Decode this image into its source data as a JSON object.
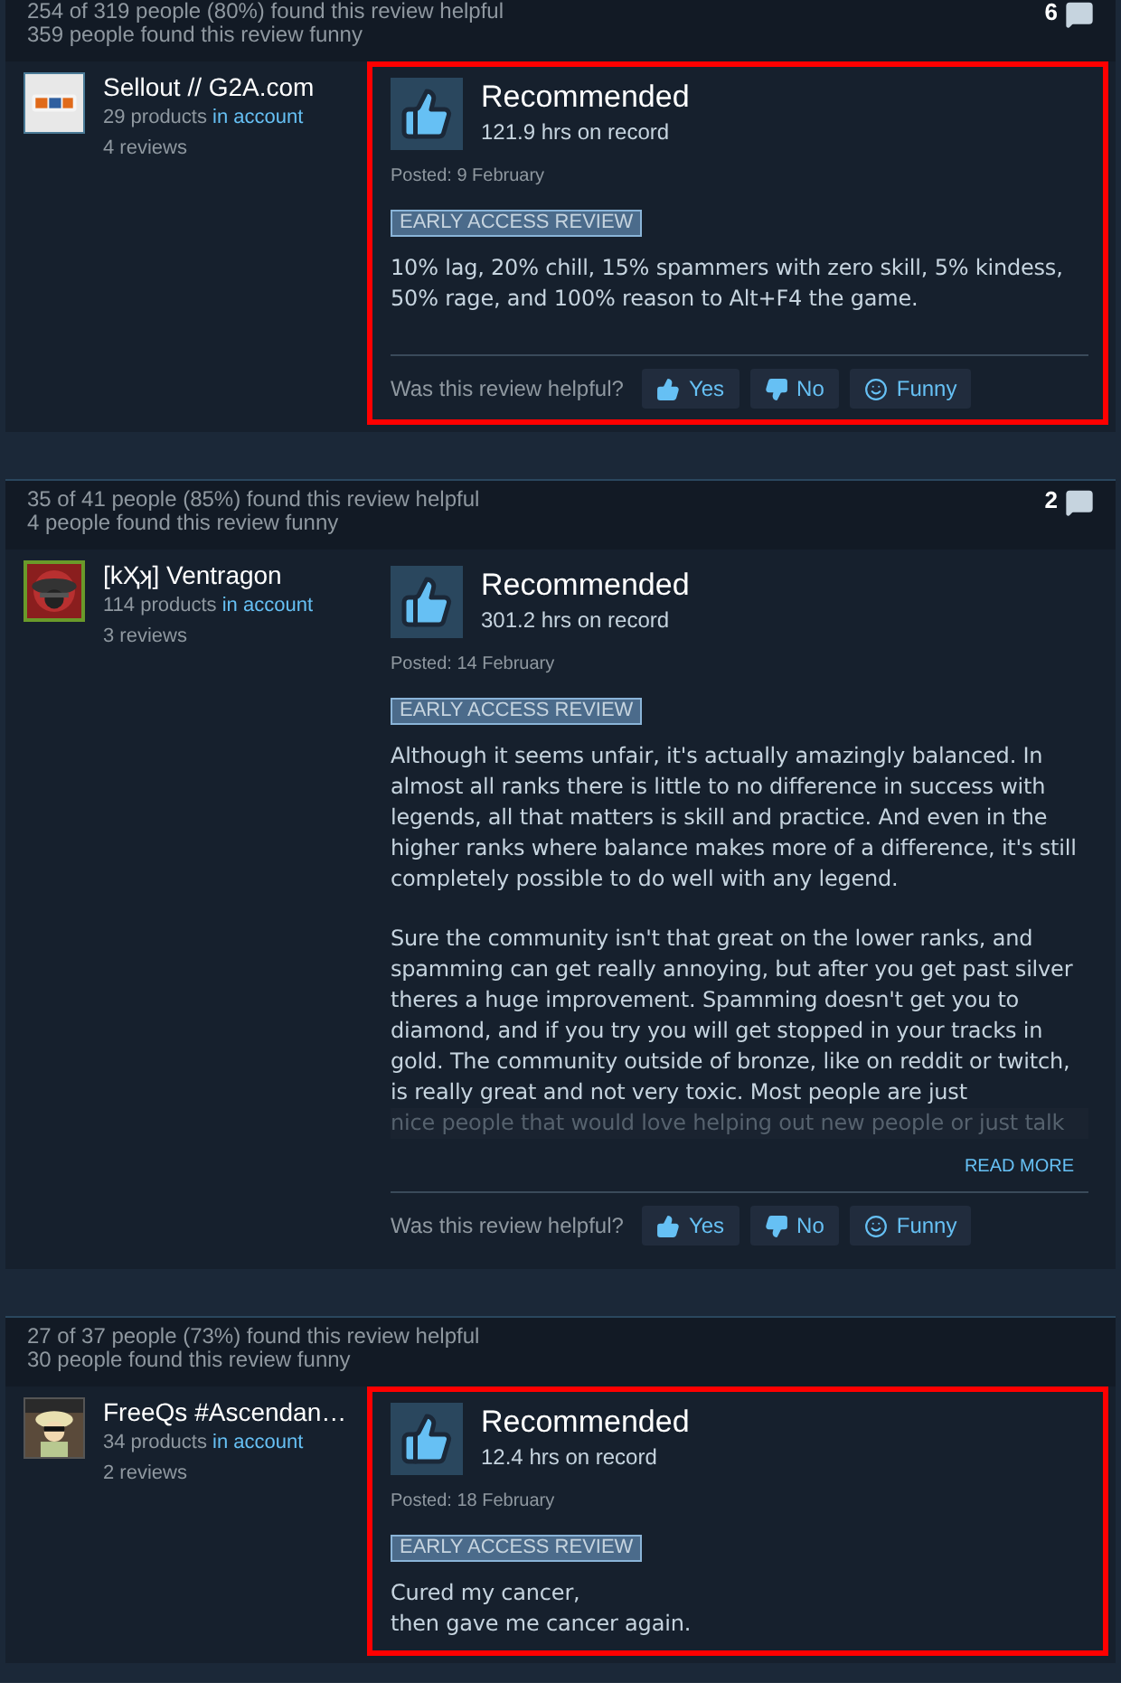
{
  "reviews": [
    {
      "helpful": "254 of 319 people (80%) found this review helpful",
      "funny": "359 people found this review funny",
      "comments": "6",
      "author": "Sellout // G2A.com",
      "products_count": "29 products",
      "products_suffix": "in account",
      "reviews_count": "4 reviews",
      "highlighted": true,
      "verdict": "Recommended",
      "hours": "121.9 hrs on record",
      "posted": "Posted: 9 February",
      "tag": "EARLY ACCESS REVIEW",
      "paragraphs": [
        "10% lag, 20% chill, 15% spammers with zero skill, 5% kindess, 50% rage, and 100% reason to Alt+F4 the game."
      ],
      "helpful_prompt": "Was this review helpful?",
      "votes": [
        "Yes",
        "No",
        "Funny"
      ]
    },
    {
      "helpful": "35 of 41 people (85%) found this review helpful",
      "funny": "4 people found this review funny",
      "comments": "2",
      "author": "[kҲʞ] Ventragon",
      "products_count": "114 products",
      "products_suffix": "in account",
      "reviews_count": "3 reviews",
      "highlighted": false,
      "verdict": "Recommended",
      "hours": "301.2 hrs on record",
      "posted": "Posted: 14 February",
      "tag": "EARLY ACCESS REVIEW",
      "paragraphs": [
        "Although it seems unfair, it's actually amazingly balanced. In almost all ranks there is little to no difference in success with legends, all that matters is skill and practice. And even in the higher ranks where balance makes more of a difference, it's still completely possible to do well with any legend.",
        "Sure the community isn't that great on the lower ranks, and spamming can get really annoying, but after you get past silver theres a huge improvement. Spamming doesn't get you to diamond, and if you try you will get stopped in your tracks in gold. The community outside of bronze, like on reddit or twitch, is really great and not very toxic. Most people are just"
      ],
      "faded_line": "nice people that would love helping out new people or just talk",
      "read_more": "READ MORE",
      "helpful_prompt": "Was this review helpful?",
      "votes": [
        "Yes",
        "No",
        "Funny"
      ]
    },
    {
      "helpful": "27 of 37 people (73%) found this review helpful",
      "funny": "30 people found this review funny",
      "author": "FreeQs #Ascendan…",
      "products_count": "34 products",
      "products_suffix": "in account",
      "reviews_count": "2 reviews",
      "highlighted": true,
      "verdict": "Recommended",
      "hours": "12.4 hrs on record",
      "posted": "Posted: 18 February",
      "tag": "EARLY ACCESS REVIEW",
      "paragraphs": [
        "Cured my cancer,\nthen gave me cancer again."
      ]
    }
  ]
}
